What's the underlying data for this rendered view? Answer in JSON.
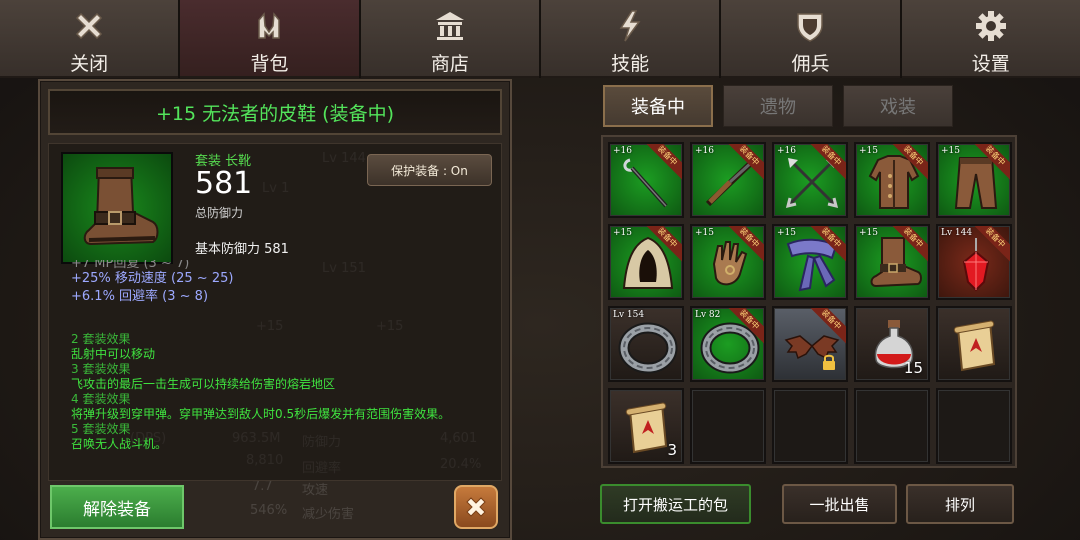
{
  "top_tabs": [
    {
      "label": "关闭",
      "icon": "close-x-icon"
    },
    {
      "label": "背包",
      "icon": "backpack-icon"
    },
    {
      "label": "商店",
      "icon": "shop-building-icon"
    },
    {
      "label": "技能",
      "icon": "lightning-icon"
    },
    {
      "label": "佣兵",
      "icon": "shield-icon"
    },
    {
      "label": "设置",
      "icon": "gear-icon"
    }
  ],
  "active_tab": "背包",
  "item": {
    "title": "+15 无法者的皮鞋 (装备中)",
    "type": "套装 长靴",
    "value": "581",
    "value_label": "总防御力",
    "base_defense": "基本防御力 581",
    "protect_button": "保护装备 : On",
    "stats": [
      {
        "text": "+7 MP回复 (3 ~ 7)",
        "faded": true
      },
      {
        "text": "+25% 移动速度 (25 ~ 25)",
        "faded": false
      },
      {
        "text": "+6.1% 回避率 (3 ~ 8)",
        "faded": false
      }
    ],
    "set_effects": [
      {
        "header": "2 套装效果",
        "desc": "乱射中可以移动"
      },
      {
        "header": "3 套装效果",
        "desc": "飞攻击的最后一击生成可以持续给伤害的熔岩地区"
      },
      {
        "header": "4 套装效果",
        "desc": "将弹升级到穿甲弹。穿甲弹达到敌人时0.5秒后爆发并有范围伤害效果。"
      },
      {
        "header": "5 套装效果",
        "desc": "召唤无人战斗机。"
      }
    ],
    "unequip_button": "解除装备",
    "color_title": "#53e45b"
  },
  "background_text": [
    "Lv 144",
    "Lv 1",
    "Lv 151",
    "+15",
    "+15",
    "(DPS)",
    "963.5M",
    "防御力",
    "4,601",
    "8,810",
    "回避率",
    "20.4%",
    "7.7",
    "攻速",
    "546%",
    "减少伤害"
  ],
  "sub_tabs": [
    {
      "label": "装备中",
      "active": true
    },
    {
      "label": "遗物",
      "active": false
    },
    {
      "label": "戏装",
      "active": false
    }
  ],
  "equipped_ribbon": "装备中",
  "inventory": [
    {
      "level": "+16",
      "bg": "green",
      "art": "staff",
      "equipped": true
    },
    {
      "level": "+16",
      "bg": "green",
      "art": "rifle",
      "equipped": true
    },
    {
      "level": "+16",
      "bg": "green",
      "art": "crossed-arrows",
      "equipped": true
    },
    {
      "level": "+15",
      "bg": "green",
      "art": "leather-coat",
      "equipped": true
    },
    {
      "level": "+15",
      "bg": "green",
      "art": "pants",
      "equipped": true
    },
    {
      "level": "+15",
      "bg": "green",
      "art": "hood",
      "equipped": true
    },
    {
      "level": "+15",
      "bg": "green",
      "art": "glove",
      "equipped": true
    },
    {
      "level": "+15",
      "bg": "green",
      "art": "scarf",
      "equipped": true
    },
    {
      "level": "+15",
      "bg": "green",
      "art": "boot",
      "equipped": true
    },
    {
      "level": "Lv 144",
      "bg": "red",
      "art": "red-gem",
      "equipped": true
    },
    {
      "level": "Lv 154",
      "bg": "dark",
      "art": "ring",
      "equipped": false
    },
    {
      "level": "Lv 82",
      "bg": "green",
      "art": "ring",
      "equipped": true
    },
    {
      "level": "",
      "bg": "silver",
      "art": "bat-wings",
      "equipped": true,
      "locked": true
    },
    {
      "level": "",
      "bg": "dark",
      "art": "red-potion",
      "count": "15"
    },
    {
      "level": "",
      "bg": "dark",
      "art": "scroll"
    },
    {
      "level": "",
      "bg": "dark",
      "art": "scroll",
      "count": "3"
    },
    {
      "empty": true
    },
    {
      "empty": true
    },
    {
      "empty": true
    },
    {
      "empty": true
    }
  ],
  "bottom_buttons": {
    "porter_bag": "打开搬运工的包",
    "bulk_sell": "一批出售",
    "sort": "排列"
  }
}
